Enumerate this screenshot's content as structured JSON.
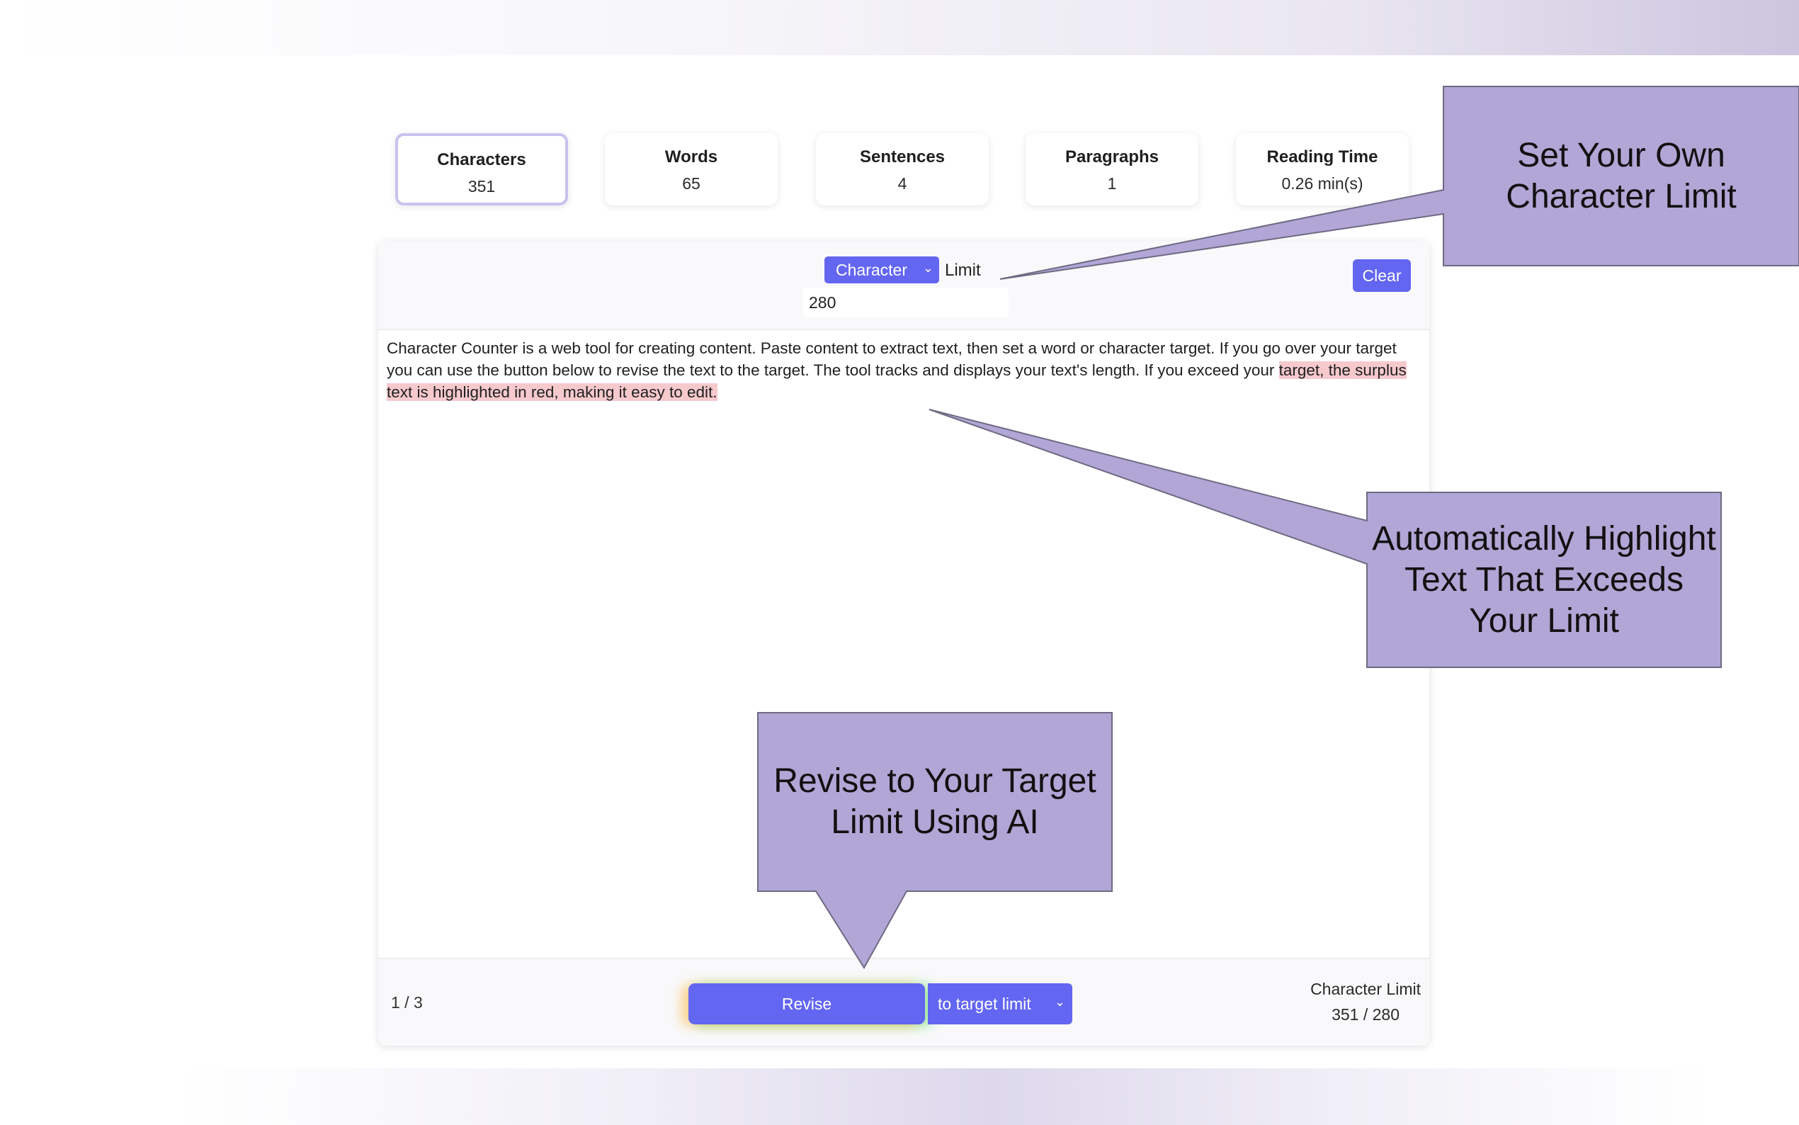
{
  "stats": [
    {
      "label": "Characters",
      "value": "351"
    },
    {
      "label": "Words",
      "value": "65"
    },
    {
      "label": "Sentences",
      "value": "4"
    },
    {
      "label": "Paragraphs",
      "value": "1"
    },
    {
      "label": "Reading Time",
      "value": "0.26 min(s)"
    }
  ],
  "toolbar": {
    "mode_label": "Character",
    "limit_label": "Limit",
    "limit_value": "280",
    "clear_label": "Clear"
  },
  "editor": {
    "text_within": "Character Counter is a web tool for creating content. Paste content to extract text, then set a word or character target. If you go over your target you can use the button below to revise the text to the target. The tool tracks and displays your text's length. If you exceed your ",
    "text_over": "target, the surplus text is highlighted in red, making it easy to edit."
  },
  "footer": {
    "pager": "1 / 3",
    "revise_label": "Revise",
    "target_label": "to target limit",
    "limit_title": "Character Limit",
    "limit_count": "351 / 280"
  },
  "callouts": {
    "set_limit": "Set Your Own Character Limit",
    "highlight": "Automatically Highlight Text That Exceeds Your Limit",
    "revise": "Revise to Your Target Limit Using AI"
  },
  "colors": {
    "accent": "#6366f1",
    "callout_fill": "#b1a6d6",
    "overflow_highlight": "#f6c9cd"
  },
  "icons": {
    "mode_dropdown": "chevron-down-icon",
    "target_dropdown": "chevron-down-icon"
  }
}
